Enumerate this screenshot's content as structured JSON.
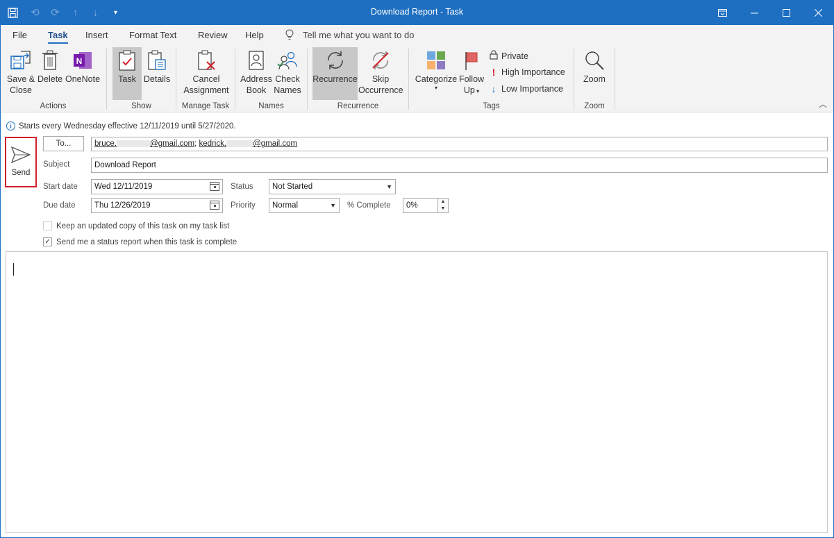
{
  "window": {
    "title": "Download Report  -  Task"
  },
  "qat": {
    "save_icon": "save-icon",
    "undo_icon": "undo-icon",
    "redo_icon": "redo-icon",
    "up_icon": "arrow-up-icon",
    "down_icon": "arrow-down-icon",
    "customize_icon": "customize-qat-icon"
  },
  "tabs": [
    {
      "label": "File"
    },
    {
      "label": "Task"
    },
    {
      "label": "Insert"
    },
    {
      "label": "Format Text"
    },
    {
      "label": "Review"
    },
    {
      "label": "Help"
    }
  ],
  "tellme": "Tell me what you want to do",
  "ribbon": {
    "actions": {
      "label": "Actions",
      "save_close_1": "Save &",
      "save_close_2": "Close",
      "delete": "Delete",
      "onenote": "OneNote"
    },
    "show": {
      "label": "Show",
      "task": "Task",
      "details": "Details"
    },
    "manage": {
      "label": "Manage Task",
      "cancel_1": "Cancel",
      "cancel_2": "Assignment"
    },
    "names": {
      "label": "Names",
      "address_1": "Address",
      "address_2": "Book",
      "check_1": "Check",
      "check_2": "Names"
    },
    "recurrence": {
      "label": "Recurrence",
      "recurrence": "Recurrence",
      "skip_1": "Skip",
      "skip_2": "Occurrence"
    },
    "tags": {
      "label": "Tags",
      "categorize": "Categorize",
      "follow_1": "Follow",
      "follow_2": "Up",
      "private": "Private",
      "high": "High Importance",
      "low": "Low Importance"
    },
    "zoom": {
      "label": "Zoom",
      "zoom": "Zoom"
    }
  },
  "info": "Starts every Wednesday effective 12/11/2019 until 5/27/2020.",
  "send": {
    "label": "Send"
  },
  "form": {
    "to_button": "To...",
    "to_part1": "bruce.",
    "to_part2": "@gmail.com",
    "to_sep": "; ",
    "to_part3": "kedrick.",
    "to_part4": "@gmail.com",
    "subject_label": "Subject",
    "subject": "Download Report",
    "start_label": "Start date",
    "start": "Wed 12/11/2019",
    "due_label": "Due date",
    "due": "Thu 12/26/2019",
    "status_label": "Status",
    "status": "Not Started",
    "priority_label": "Priority",
    "priority": "Normal",
    "complete_label": "% Complete",
    "complete": "0%",
    "keep_copy": "Keep an updated copy of this task on my task list",
    "status_report": "Send me a status report when this task is complete"
  }
}
